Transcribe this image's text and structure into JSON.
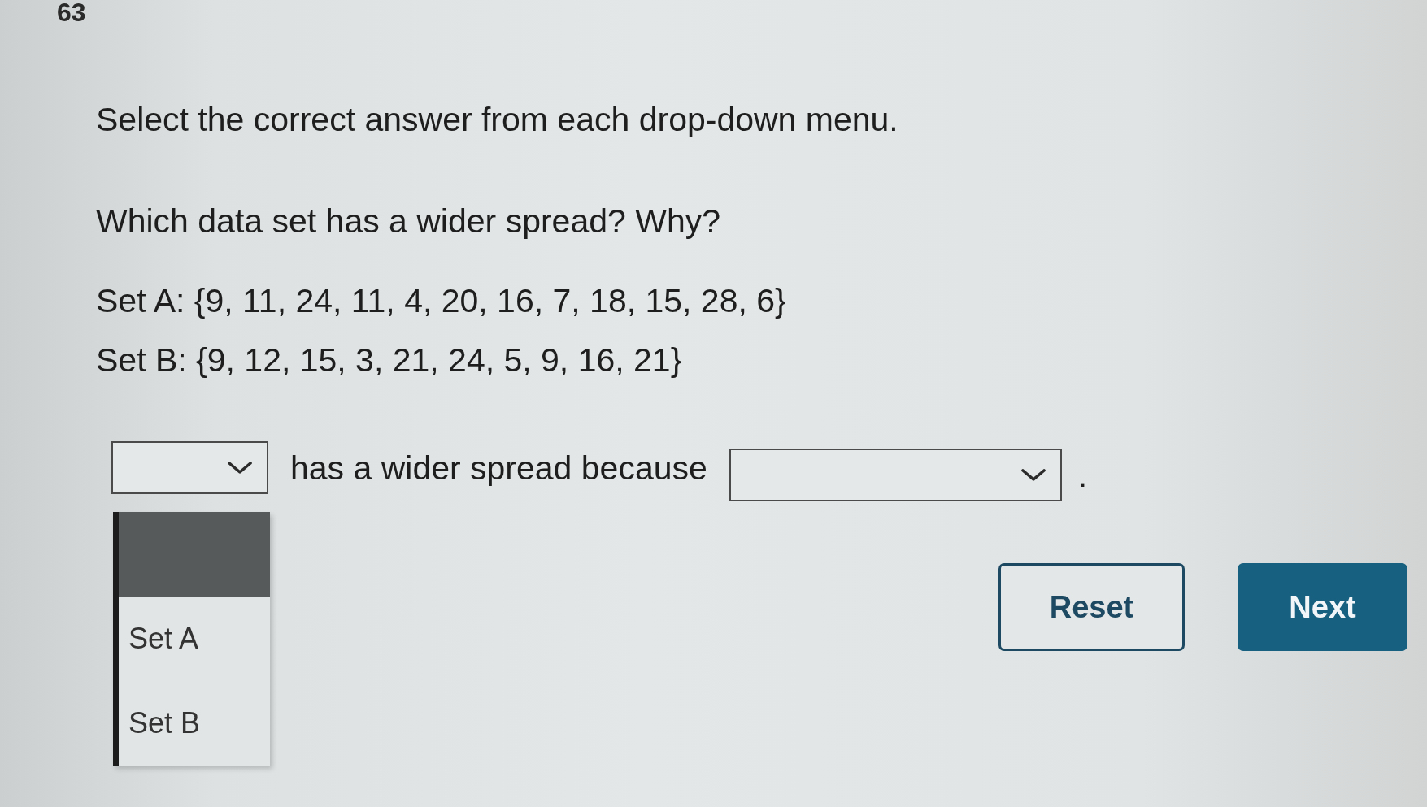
{
  "question_number": "63",
  "instruction": "Select the correct answer from each drop-down menu.",
  "question": "Which data set has a wider spread? Why?",
  "data_sets": [
    {
      "text": "Set A: {9, 11, 24, 11, 4, 20, 16, 7, 18, 15, 28, 6}"
    },
    {
      "text": "Set B: {9, 12, 15, 3, 21, 24, 5, 9, 16, 21}"
    }
  ],
  "sentence": [
    {
      "kind": "dropdown",
      "open_menu": {
        "options": [
          {
            "kind": "blank",
            "highlighted": true
          },
          {
            "kind": "text",
            "label": "Set A",
            "highlighted": false
          },
          {
            "kind": "text",
            "label": "Set B",
            "highlighted": false
          }
        ]
      }
    },
    {
      "kind": "text",
      "text": "has a wider spread because"
    },
    {
      "kind": "dropdown"
    },
    {
      "kind": "text",
      "text": "."
    }
  ],
  "buttons": [
    {
      "kind": "outline",
      "label": "Reset"
    },
    {
      "kind": "filled",
      "label": "Next"
    }
  ]
}
